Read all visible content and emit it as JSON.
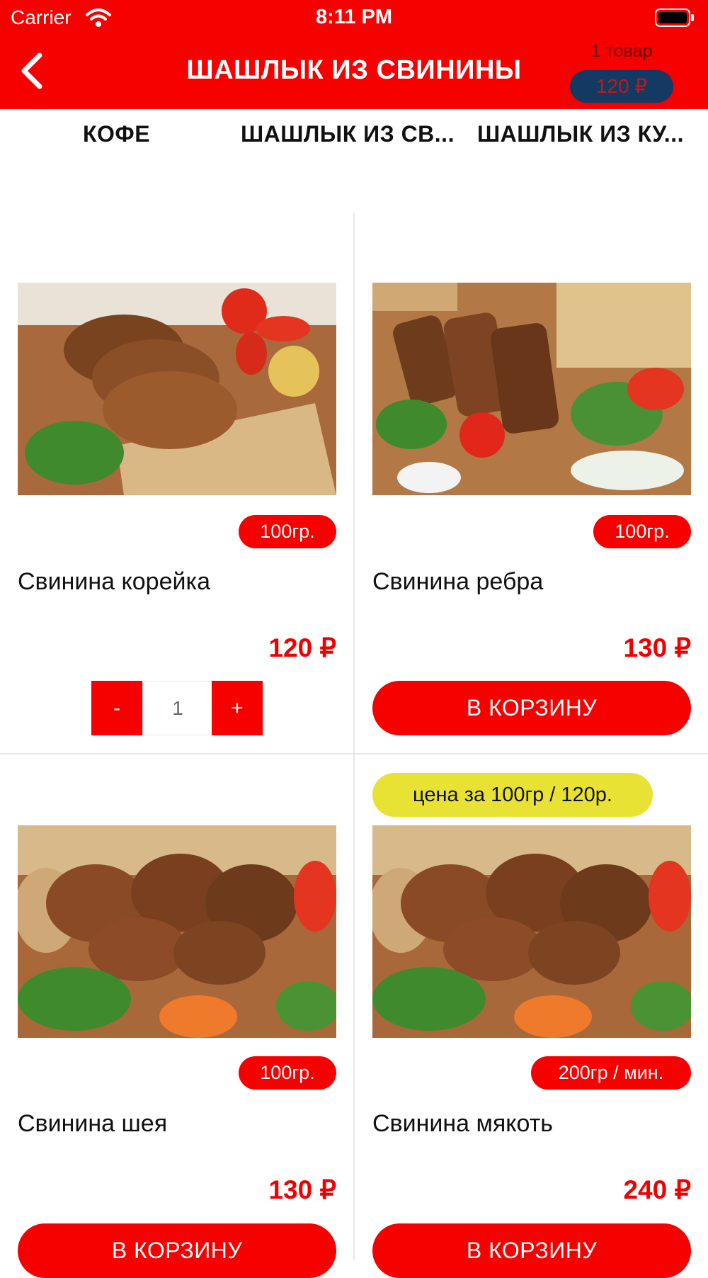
{
  "status_bar": {
    "carrier": "Carrier",
    "time": "8:11 PM"
  },
  "header": {
    "title": "ШАШЛЫК ИЗ СВИНИНЫ",
    "cart_count": "1 товар",
    "cart_total": "120 ₽"
  },
  "tabs": [
    "КОФЕ",
    "ШАШЛЫК ИЗ СВ...",
    "ШАШЛЫК ИЗ КУ..."
  ],
  "products": [
    {
      "name": "Свинина корейка",
      "weight": "100гр.",
      "price": "120 ₽",
      "quantity": "1",
      "minus": "-",
      "plus": "+"
    },
    {
      "name": "Свинина ребра",
      "weight": "100гр.",
      "price": "130 ₽",
      "button": "В КОРЗИНУ"
    },
    {
      "name": "Свинина шея",
      "weight": "100гр.",
      "price": "130 ₽",
      "button": "В КОРЗИНУ"
    },
    {
      "name": "Свинина мякоть",
      "weight": "200гр / мин.",
      "price": "240 ₽",
      "button": "В КОРЗИНУ",
      "note": "цена за 100гр / 120р."
    }
  ],
  "colors": {
    "brand": "#f70000",
    "cart_badge": "#123a63",
    "note_badge": "#e7e233",
    "divider": "#e6e6e6"
  }
}
